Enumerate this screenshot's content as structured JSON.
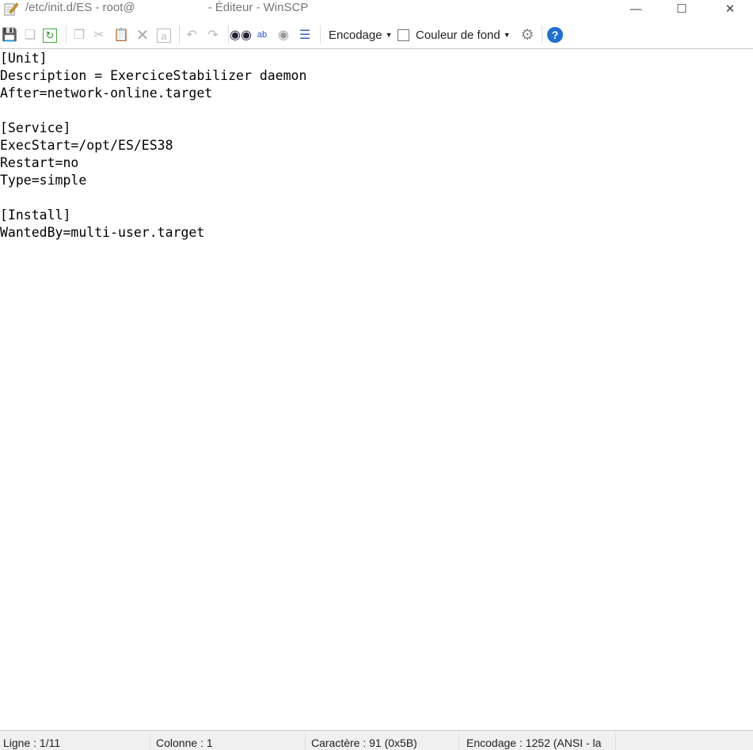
{
  "window": {
    "title_prefix": "/etc/init.d/ES - root@",
    "title_suffix": "- Éditeur - WinSCP",
    "minimize": "—",
    "maximize": "☐",
    "close": "✕"
  },
  "toolbar": {
    "encoding_label": "Encodage",
    "background_color_label": "Couleur de fond",
    "background_color_checked": false,
    "help_label": "?"
  },
  "editor": {
    "lines": [
      "[Unit]",
      "Description = ExerciceStabilizer daemon",
      "After=network-online.target",
      "",
      "[Service]",
      "ExecStart=/opt/ES/ES38",
      "Restart=no",
      "Type=simple",
      "",
      "[Install]",
      "WantedBy=multi-user.target"
    ]
  },
  "status": {
    "line": "Ligne : 1/11",
    "column": "Colonne : 1",
    "character": "Caractère : 91 (0x5B)",
    "encoding": "Encodage : 1252  (ANSI - la"
  }
}
